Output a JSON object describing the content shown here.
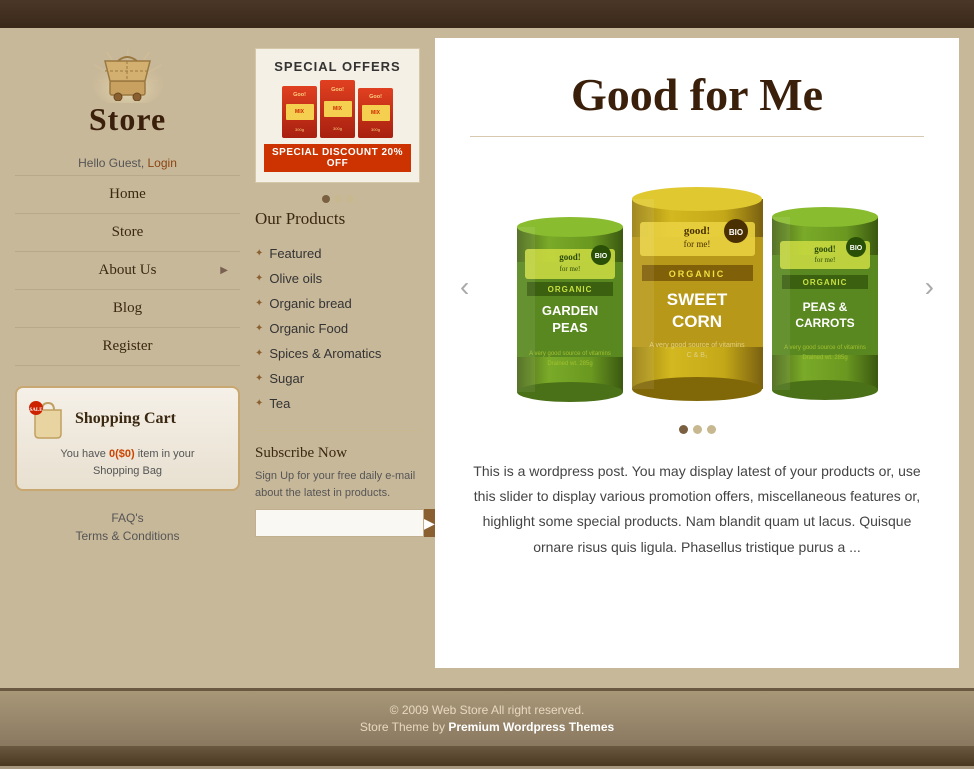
{
  "topbar": {},
  "sidebar": {
    "logo_text": "Store",
    "hello_text": "Hello Guest,",
    "login_text": "Login",
    "nav_items": [
      {
        "label": "Home",
        "has_submenu": false
      },
      {
        "label": "Store",
        "has_submenu": false
      },
      {
        "label": "About Us",
        "has_submenu": true
      },
      {
        "label": "Blog",
        "has_submenu": false
      },
      {
        "label": "Register",
        "has_submenu": false
      }
    ],
    "cart": {
      "title": "Shopping Cart",
      "info_line1": "You have",
      "amount": "0($0)",
      "info_line2": "item in your",
      "bag_label": "Shopping Bag"
    },
    "footer_links": [
      {
        "label": "FAQ's"
      },
      {
        "label": "Terms & Conditions"
      }
    ]
  },
  "middle": {
    "special_offers": {
      "title": "SPECIAL OFFERS",
      "discount_label": "SPECIAL DISCOUNT 20% OFF",
      "product_boxes": [
        "MIX",
        "MIX",
        "MIX"
      ]
    },
    "products_title": "Our Products",
    "product_list": [
      {
        "label": "Featured"
      },
      {
        "label": "Olive oils"
      },
      {
        "label": "Organic bread"
      },
      {
        "label": "Organic Food"
      },
      {
        "label": "Spices & Aromatics"
      },
      {
        "label": "Sugar"
      },
      {
        "label": "Tea"
      }
    ],
    "subscribe": {
      "title": "Subscribe Now",
      "text": "Sign Up for your free daily e-mail about the latest in products.",
      "input_placeholder": ""
    }
  },
  "main": {
    "hero_title": "Good for Me",
    "slider_prev": "‹",
    "slider_next": "›",
    "cans": [
      {
        "name": "Garden Peas",
        "color_top": "#7a9830",
        "color_mid": "#5a7820",
        "label": "GARDEN\nPEAS",
        "size": "small"
      },
      {
        "name": "Sweet Corn",
        "color_top": "#c8b820",
        "color_mid": "#a89810",
        "label": "SWEET\nCORN",
        "size": "large"
      },
      {
        "name": "Peas & Carrots",
        "color_top": "#7a9830",
        "color_mid": "#5a7820",
        "label": "PEAS &\nCARROTS",
        "size": "medium"
      }
    ],
    "description": "This is a wordpress post. You may display latest of your products or, use this slider to display various promotion offers, miscellaneous features or, highlight some special products. Nam blandit quam ut lacus. Quisque ornare risus quis ligula. Phasellus tristique purus a ..."
  },
  "footer": {
    "copyright": "© 2009 Web Store All right reserved.",
    "theme_text": "Store Theme by",
    "theme_link_label": "Premium Wordpress Themes"
  }
}
